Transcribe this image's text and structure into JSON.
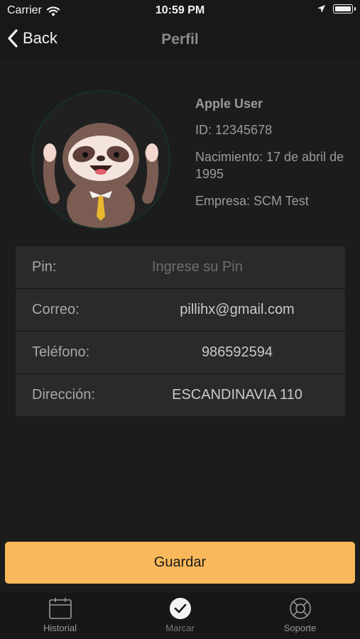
{
  "status_bar": {
    "carrier": "Carrier",
    "time": "10:59 PM",
    "battery_level": 1.0
  },
  "nav": {
    "back_label": "Back",
    "title": "Perfil"
  },
  "profile": {
    "name": "Apple User",
    "id": "ID: 12345678",
    "birth": "Nacimiento: 17 de abril de 1995",
    "company": "Empresa: SCM Test"
  },
  "form": {
    "pin": {
      "label": "Pin:",
      "placeholder": "Ingrese su Pin",
      "value": ""
    },
    "email": {
      "label": "Correo:",
      "value": "pillihx@gmail.com"
    },
    "phone": {
      "label": "Teléfono:",
      "value": "986592594"
    },
    "address": {
      "label": "Dirección:",
      "value": "ESCANDINAVIA 110"
    }
  },
  "save_label": "Guardar",
  "tabs": {
    "historial": {
      "label": "Historial",
      "icon": "calendar-icon"
    },
    "marcar": {
      "label": "Marcar",
      "icon": "check-circle-icon"
    },
    "soporte": {
      "label": "Soporte",
      "icon": "lifebuoy-icon"
    }
  },
  "colors": {
    "accent": "#f9b85a",
    "background": "#1c1c1c",
    "panel": "#2a2a2a"
  }
}
